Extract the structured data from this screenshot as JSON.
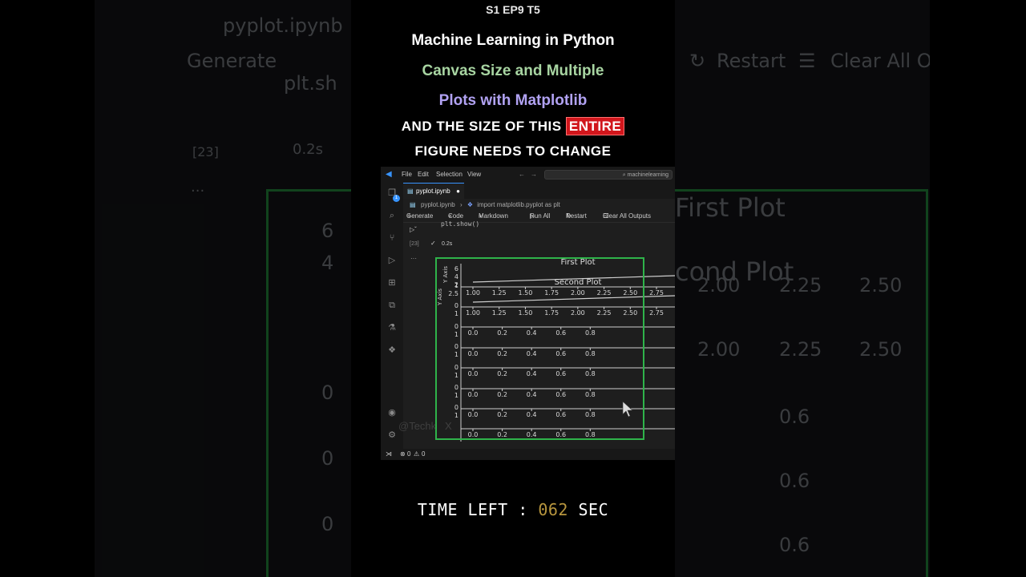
{
  "header": {
    "episode": "S1 EP9 T5",
    "title_line1": "Machine Learning in Python",
    "title_line2": "Canvas Size and Multiple",
    "title_line3": "Plots with Matplotlib"
  },
  "caption": {
    "line1_pre": "AND THE SIZE OF THIS",
    "line1_highlight": "ENTIRE",
    "line2": "FIGURE NEEDS TO CHANGE"
  },
  "vscode": {
    "menu": [
      "File",
      "Edit",
      "Selection",
      "View"
    ],
    "search_text": "machinelearning",
    "tab_label": "pyplot.ipynb",
    "breadcrumb_file": "pyplot.ipynb",
    "breadcrumb_symbol": "import matplotlib.pyplot as plt",
    "toolbar": {
      "generate": "Generate",
      "code": "Code",
      "markdown": "Markdown",
      "run_all": "Run All",
      "restart": "Restart",
      "clear_all": "Clear All Outputs"
    },
    "cell_code": "plt.show()",
    "exec_count": "[23]",
    "exec_time": "0.2s",
    "status_errors": "0",
    "status_warnings": "0",
    "badge_count": "1",
    "more": "···"
  },
  "background": {
    "file_name": "pyplot.ipynb",
    "generate": "Generate",
    "restart": "Restart",
    "clear_all": "Clear All Outputs",
    "code_line": "plt.sh",
    "exec_count": "[23]",
    "exec_time": "0.2s",
    "first_plot": "First Plot",
    "second_plot": "cond Plot",
    "more": "···"
  },
  "chart_data": {
    "type": "line",
    "subplots": [
      {
        "title": "First Plot",
        "xlabel": "",
        "ylabel": "Y Axis",
        "xticks": [
          "1.00",
          "1.25",
          "1.50",
          "1.75",
          "2.00",
          "2.25",
          "2.50",
          "2.75"
        ],
        "yticks": [
          "2",
          "4",
          "6"
        ]
      },
      {
        "title": "Second Plot",
        "xlabel": "",
        "ylabel": "Y Axis",
        "xticks": [
          "1.00",
          "1.25",
          "1.50",
          "1.75",
          "2.00",
          "2.25",
          "2.50",
          "2.75"
        ],
        "yticks": [
          "1",
          "2.5"
        ]
      },
      {
        "title": "",
        "xticks": [
          "0.0",
          "0.2",
          "0.4",
          "0.6",
          "0.8"
        ],
        "yticks": [
          "0",
          "1"
        ]
      },
      {
        "title": "",
        "xticks": [
          "0.0",
          "0.2",
          "0.4",
          "0.6",
          "0.8"
        ],
        "yticks": [
          "0",
          "1"
        ]
      },
      {
        "title": "",
        "xticks": [
          "0.0",
          "0.2",
          "0.4",
          "0.6",
          "0.8"
        ],
        "yticks": [
          "0",
          "1"
        ]
      },
      {
        "title": "",
        "xticks": [
          "0.0",
          "0.2",
          "0.4",
          "0.6",
          "0.8"
        ],
        "yticks": [
          "0",
          "1"
        ]
      },
      {
        "title": "",
        "xticks": [
          "0.0",
          "0.2",
          "0.4",
          "0.6",
          "0.8"
        ],
        "yticks": [
          "0",
          "1"
        ]
      },
      {
        "title": "",
        "xticks": [
          "0.0",
          "0.2",
          "0.4",
          "0.6",
          "0.8"
        ],
        "yticks": [
          "0",
          "1"
        ]
      }
    ]
  },
  "timer": {
    "label": "TIME LEFT :",
    "value": "062",
    "unit": "SEC"
  }
}
